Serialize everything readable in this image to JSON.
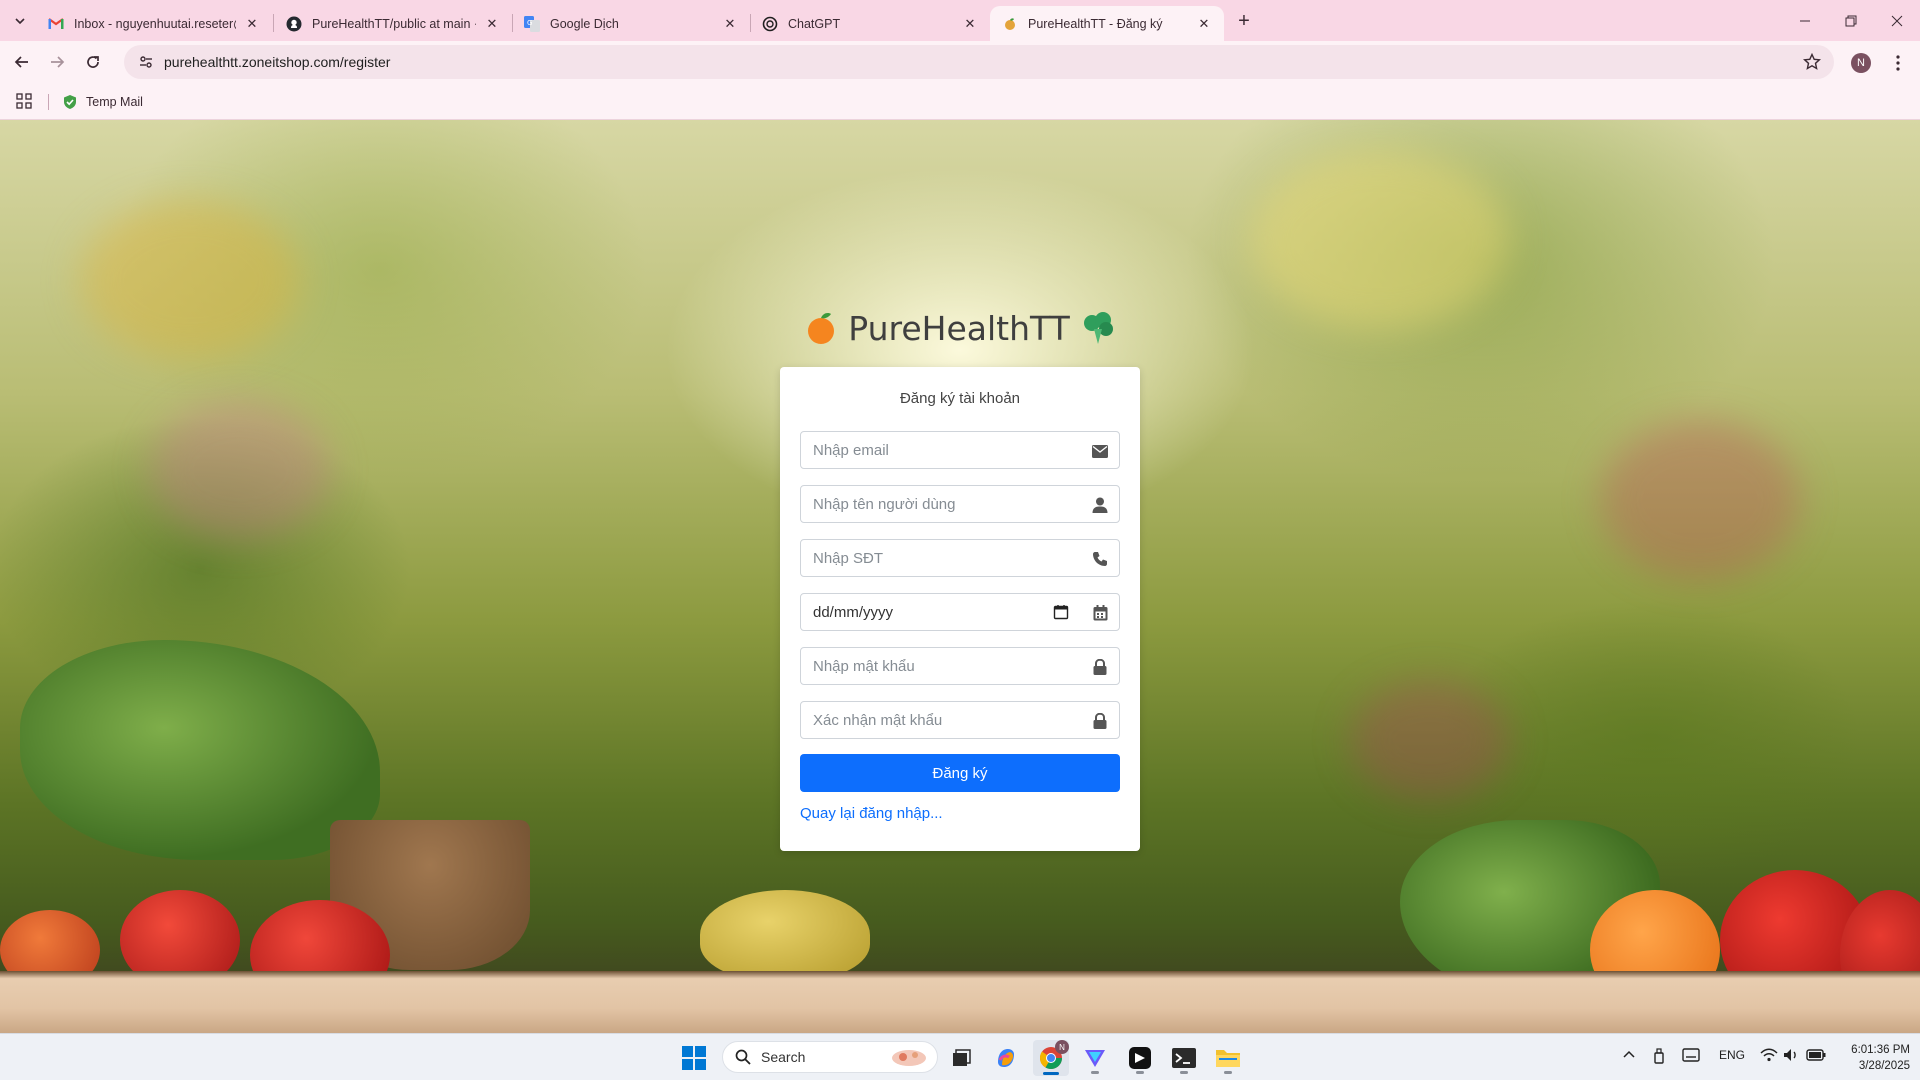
{
  "browser": {
    "tabs": [
      {
        "title": "Inbox - nguyenhuutai.reseter@",
        "icon": "gmail-icon",
        "active": false
      },
      {
        "title": "PureHealthTT/public at main · n",
        "icon": "github-icon",
        "active": false
      },
      {
        "title": "Google Dịch",
        "icon": "google-translate-icon",
        "active": false
      },
      {
        "title": "ChatGPT",
        "icon": "chatgpt-icon",
        "active": false
      },
      {
        "title": "PureHealthTT - Đăng ký",
        "icon": "leaf-icon",
        "active": true
      }
    ],
    "url": "purehealthtt.zoneitshop.com/register",
    "profile_initial": "N",
    "bookmarks": [
      {
        "label": "Temp Mail",
        "icon": "shield-check-icon"
      }
    ]
  },
  "page": {
    "brand": "PureHealthTT",
    "form": {
      "title": "Đăng ký tài khoản",
      "email_placeholder": "Nhập email",
      "username_placeholder": "Nhập tên người dùng",
      "phone_placeholder": "Nhập SĐT",
      "date_value": "dd/mm/yyyy",
      "password_placeholder": "Nhập mật khẩu",
      "confirm_placeholder": "Xác nhận mật khẩu",
      "submit_label": "Đăng ký",
      "back_link": "Quay lại đăng nhập..."
    },
    "colors": {
      "primary": "#0d6efd",
      "link": "#0d6efd"
    }
  },
  "taskbar": {
    "search_label": "Search",
    "language": "ENG",
    "time": "6:01:36 PM",
    "date": "3/28/2025",
    "chrome_badge": "N"
  }
}
